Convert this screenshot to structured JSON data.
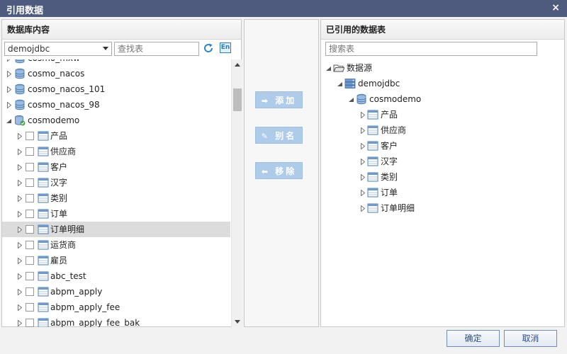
{
  "window": {
    "title": "引用数据",
    "close_glyph": "×"
  },
  "left": {
    "header": "数据库内容",
    "datasource_select": "demojdbc",
    "search_placeholder": "查找表",
    "en_label": "En",
    "partial_top": "cosmo_mxw",
    "databases": [
      "cosmo_nacos",
      "cosmo_nacos_101",
      "cosmo_nacos_98"
    ],
    "expanded_db": "cosmodemo",
    "tables": [
      "产品",
      "供应商",
      "客户",
      "汉字",
      "类别",
      "订单",
      "订单明细",
      "运货商",
      "雇员",
      "abc_test",
      "abpm_apply",
      "abpm_apply_fee",
      "abpm_apply_fee_bak"
    ],
    "highlighted_table": "订单明细"
  },
  "middle": {
    "add": "添加",
    "alias": "别名",
    "remove": "移除"
  },
  "right": {
    "header": "已引用的数据表",
    "search_placeholder": "搜索表",
    "root": "数据源",
    "datasource": "demojdbc",
    "database": "cosmodemo",
    "tables": [
      "产品",
      "供应商",
      "客户",
      "汉字",
      "类别",
      "订单",
      "订单明细"
    ]
  },
  "footer": {
    "ok": "确定",
    "cancel": "取消"
  }
}
